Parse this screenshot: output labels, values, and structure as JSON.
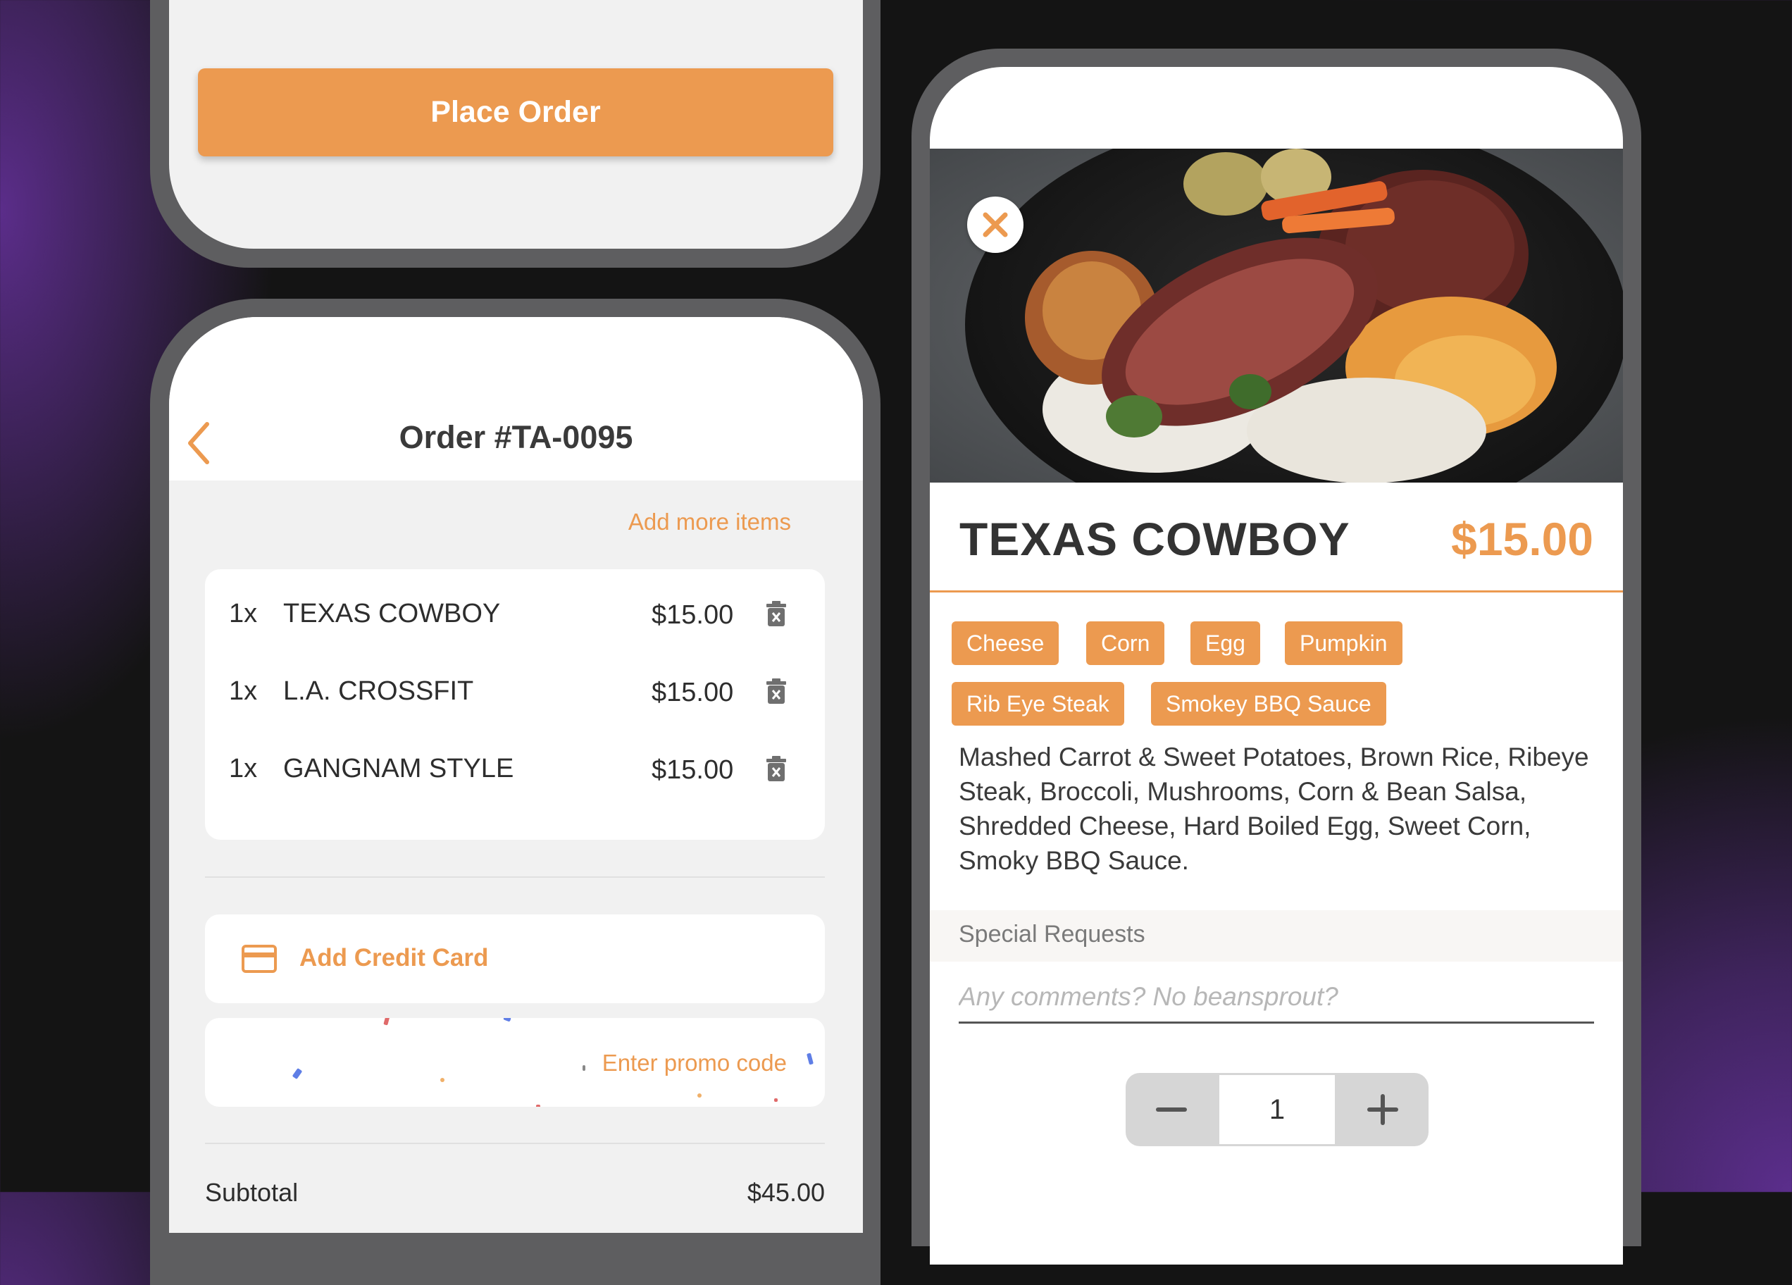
{
  "checkout_screen": {
    "place_order_label": "Place Order"
  },
  "order_screen": {
    "title": "Order #TA-0095",
    "add_more_label": "Add more items",
    "items": [
      {
        "qty": "1x",
        "name": "TEXAS COWBOY",
        "price": "$15.00"
      },
      {
        "qty": "1x",
        "name": "L.A. CROSSFIT",
        "price": "$15.00"
      },
      {
        "qty": "1x",
        "name": "GANGNAM STYLE",
        "price": "$15.00"
      }
    ],
    "add_credit_card_label": "Add Credit Card",
    "promo_placeholder": "Enter promo code",
    "subtotal_label": "Subtotal",
    "subtotal_value": "$45.00"
  },
  "meal_screen": {
    "name": "TEXAS COWBOY",
    "price": "$15.00",
    "tags": [
      "Cheese",
      "Corn",
      "Egg",
      "Pumpkin",
      "Rib Eye Steak",
      "Smokey BBQ Sauce"
    ],
    "description": "Mashed Carrot & Sweet Potatoes, Brown Rice, Ribeye Steak, Broccoli, Mushrooms, Corn & Bean Salsa, Shredded Cheese, Hard Boiled Egg, Sweet Corn, Smoky BBQ Sauce.",
    "special_requests_label": "Special Requests",
    "comments_placeholder": "Any comments? No beansprout?",
    "quantity": "1"
  },
  "colors": {
    "accent": "#ec9a50",
    "background_dark": "#141414",
    "background_purple": "#5b2d8a",
    "phone_frame": "#5e5e60",
    "screen_background": "#f1f1f1"
  },
  "icons": [
    "chevron-left-icon",
    "trash-icon",
    "credit-card-icon",
    "close-icon",
    "minus-icon",
    "plus-icon"
  ]
}
